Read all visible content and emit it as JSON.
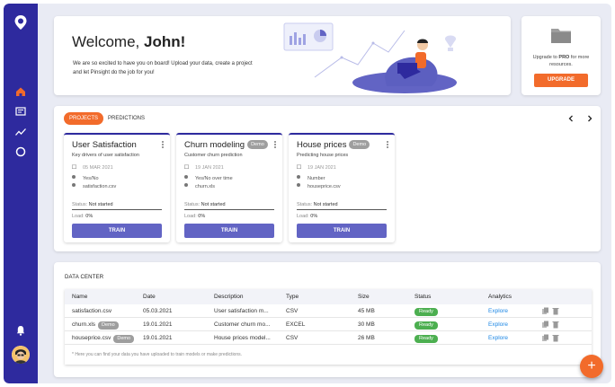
{
  "sidebar": {
    "items": [
      {
        "icon": "home-icon",
        "active": true
      },
      {
        "icon": "document-icon"
      },
      {
        "icon": "chart-line-icon"
      },
      {
        "icon": "circle-icon"
      }
    ],
    "bottom": [
      {
        "icon": "bell-icon"
      },
      {
        "icon": "avatar"
      }
    ],
    "accent": "#f26b2b",
    "bg": "#2e2a9e"
  },
  "welcome": {
    "greeting": "Welcome, ",
    "name": "John!",
    "message": "We are so excited to have you on board! Upload your data, create a project and let Pinsight do the job for you!"
  },
  "upgrade": {
    "text_prefix": "Upgrade to ",
    "text_bold": "PRO",
    "text_suffix": " for more resources.",
    "button": "UPGRADE"
  },
  "projects": {
    "tabs": [
      "PROJECTS",
      "PREDICTIONS"
    ],
    "cards": [
      {
        "title": "User Satisfaction",
        "demo": "",
        "subtitle": "Key drivers of user satisfaction",
        "date": "05 MAR 2021",
        "target": "Yes/No",
        "file": "satisfaction.csv",
        "status_label": "Status:",
        "status": "Not started",
        "load_label": "Load:",
        "load": "0%",
        "button": "TRAIN"
      },
      {
        "title": "Churn modeling",
        "demo": "Demo",
        "subtitle": "Customer churn prediction",
        "date": "19 JAN 2021",
        "target": "Yes/No over time",
        "file": "churn.xls",
        "status_label": "Status:",
        "status": "Not started",
        "load_label": "Load:",
        "load": "0%",
        "button": "TRAIN"
      },
      {
        "title": "House prices",
        "demo": "Demo",
        "subtitle": "Predicting house prices",
        "date": "19 JAN 2021",
        "target": "Number",
        "file": "houseprice.csv",
        "status_label": "Status:",
        "status": "Not started",
        "load_label": "Load:",
        "load": "0%",
        "button": "TRAIN"
      }
    ]
  },
  "datacenter": {
    "title": "DATA CENTER",
    "columns": [
      "Name",
      "Date",
      "Description",
      "Type",
      "Size",
      "Status",
      "Analytics"
    ],
    "rows": [
      {
        "name": "satisfaction.csv",
        "demo": "",
        "date": "05.03.2021",
        "description": "User satisfaction m...",
        "type": "CSV",
        "size": "45 MB",
        "status": "Ready",
        "analytics": "Explore"
      },
      {
        "name": "churn.xls",
        "demo": "Demo",
        "date": "19.01.2021",
        "description": "Customer churn mo...",
        "type": "EXCEL",
        "size": "30 MB",
        "status": "Ready",
        "analytics": "Explore"
      },
      {
        "name": "houseprice.csv",
        "demo": "Demo",
        "date": "19.01.2021",
        "description": "House prices model...",
        "type": "CSV",
        "size": "26 MB",
        "status": "Ready",
        "analytics": "Explore"
      }
    ],
    "note": "* Here you can find your data you have uploaded to train models or make predictions."
  },
  "fab": "+"
}
